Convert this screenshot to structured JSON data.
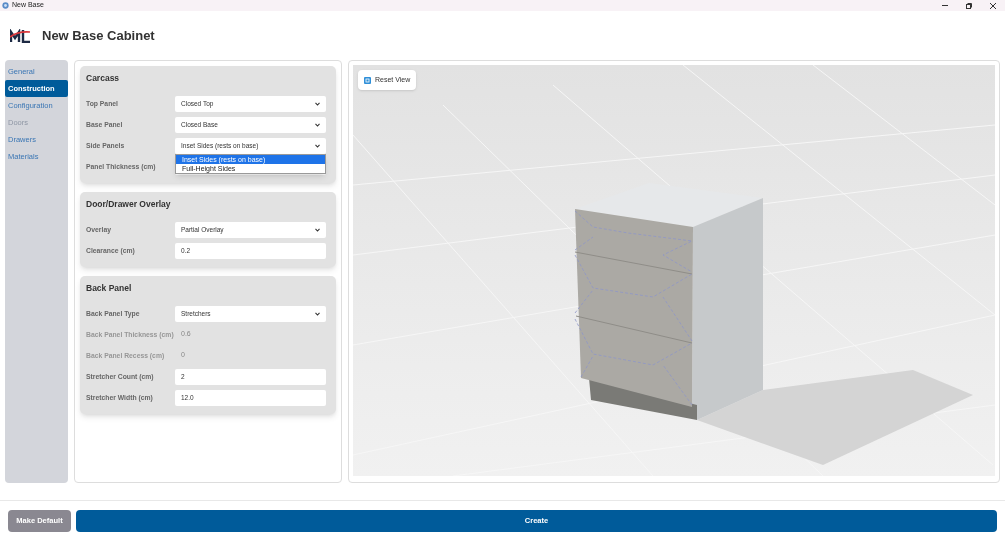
{
  "window": {
    "title": "New Base"
  },
  "header": {
    "title": "New Base Cabinet"
  },
  "sidebar": {
    "items": [
      {
        "label": "General",
        "selected": false,
        "disabled": false
      },
      {
        "label": "Construction",
        "selected": true,
        "disabled": false
      },
      {
        "label": "Configuration",
        "selected": false,
        "disabled": false
      },
      {
        "label": "Doors",
        "selected": false,
        "disabled": true
      },
      {
        "label": "Drawers",
        "selected": false,
        "disabled": false
      },
      {
        "label": "Materials",
        "selected": false,
        "disabled": false
      }
    ]
  },
  "sections": [
    {
      "title": "Carcass",
      "fields": [
        {
          "label": "Top Panel",
          "kind": "select",
          "value": "Closed Top"
        },
        {
          "label": "Base Panel",
          "kind": "select",
          "value": "Closed Base"
        },
        {
          "label": "Side Panels",
          "kind": "select",
          "value": "Inset Sides (rests on base)",
          "expanded": true,
          "options": [
            {
              "label": "Inset Sides (rests on base)",
              "selected": true
            },
            {
              "label": "Full-Height Sides",
              "selected": false
            }
          ]
        },
        {
          "label": "Panel Thickness (cm)",
          "kind": "input"
        }
      ]
    },
    {
      "title": "Door/Drawer Overlay",
      "fields": [
        {
          "label": "Overlay",
          "kind": "select",
          "value": "Partial Overlay"
        },
        {
          "label": "Clearance (cm)",
          "kind": "input",
          "value": "0.2"
        }
      ]
    },
    {
      "title": "Back Panel",
      "fields": [
        {
          "label": "Back Panel Type",
          "kind": "select",
          "value": "Stretchers"
        },
        {
          "label": "Back Panel Thickness (cm)",
          "kind": "readonly",
          "value": "0.6"
        },
        {
          "label": "Back Panel Recess (cm)",
          "kind": "readonly",
          "value": "0"
        },
        {
          "label": "Stretcher Count (cm)",
          "kind": "input",
          "value": "2"
        },
        {
          "label": "Stretcher Width (cm)",
          "kind": "input",
          "value": "12.0"
        }
      ]
    }
  ],
  "viewport": {
    "reset_button": "Reset View"
  },
  "footer": {
    "buttons": [
      {
        "label": "Make Default",
        "kind": "secondary"
      },
      {
        "label": "Create",
        "kind": "primary"
      }
    ]
  }
}
